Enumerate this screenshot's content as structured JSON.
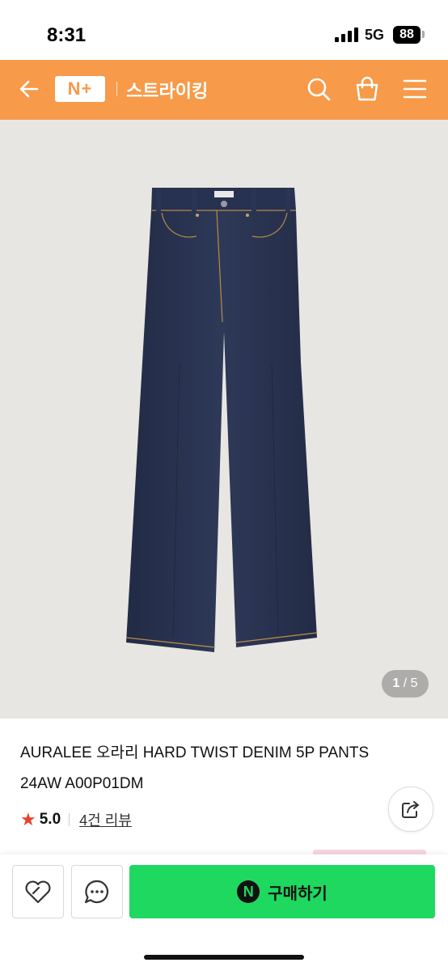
{
  "status_bar": {
    "time": "8:31",
    "network": "5G",
    "battery": "88"
  },
  "header": {
    "logo_text": "N+",
    "brand": "스트라이킹",
    "icons": [
      "back-arrow-icon",
      "search-icon",
      "shopping-bag-icon",
      "menu-icon"
    ],
    "accent": "#f79a49"
  },
  "gallery": {
    "current": "1",
    "total": "/ 5",
    "image_alt": "dark indigo straight denim jeans"
  },
  "product": {
    "title": "AURALEE 오라리 HARD TWIST DENIM 5P PANTS 24AW A00P01DM",
    "rating": "5.0",
    "reviews_label": "4건 리뷰"
  },
  "actions": {
    "buy_label": "구매하기",
    "npay_mark": "N",
    "buy_color": "#1ed85f"
  }
}
